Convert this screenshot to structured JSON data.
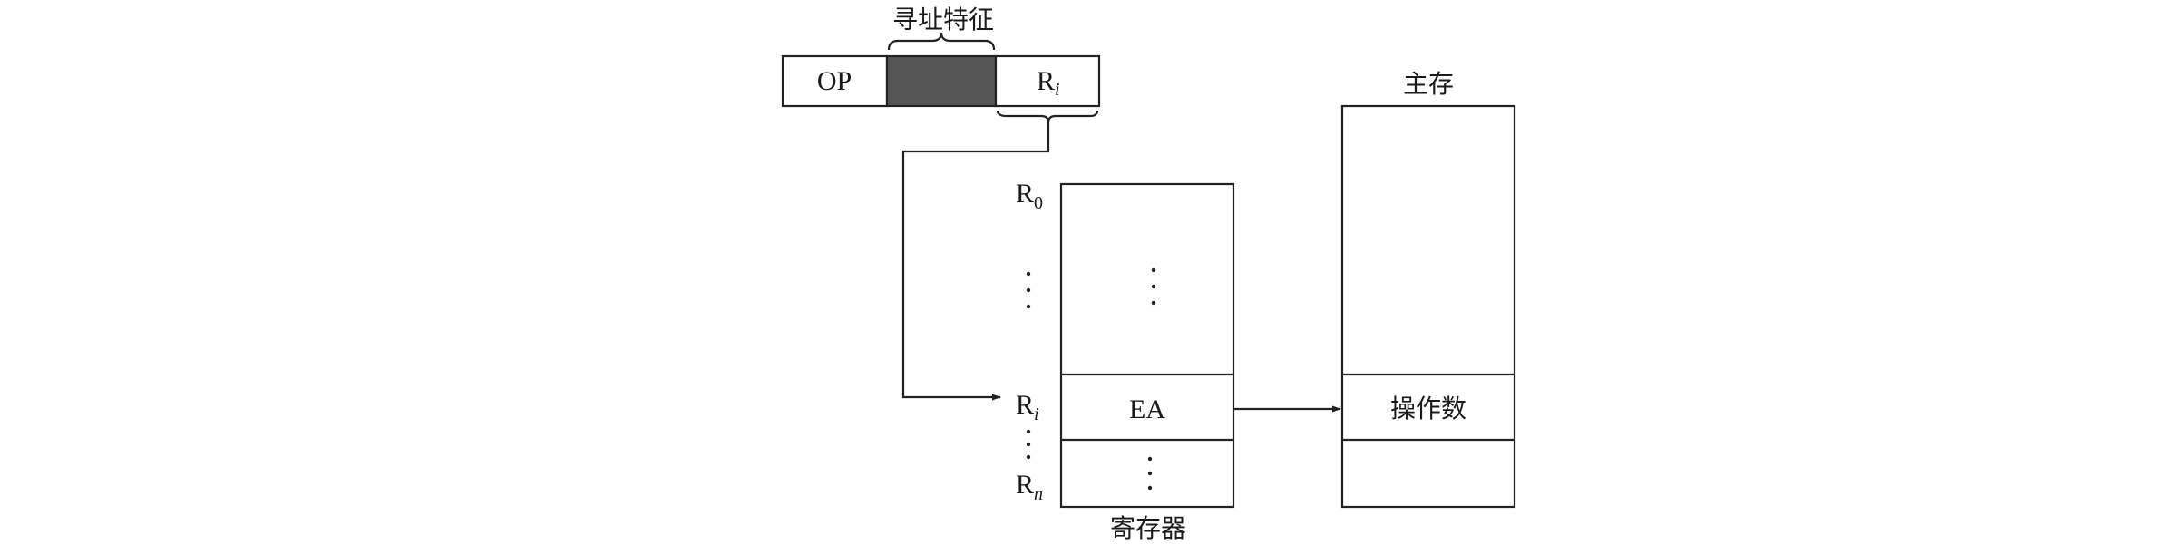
{
  "instruction": {
    "op_label": "OP",
    "addr_mode_label": "寻址特征",
    "reg_field_main": "R",
    "reg_field_sub": "i"
  },
  "registers": {
    "title": "寄存器",
    "r0_main": "R",
    "r0_sub": "0",
    "ri_main": "R",
    "ri_sub": "i",
    "rn_main": "R",
    "rn_sub": "n",
    "ea_label": "EA"
  },
  "memory": {
    "title": "主存",
    "operand_label": "操作数"
  }
}
